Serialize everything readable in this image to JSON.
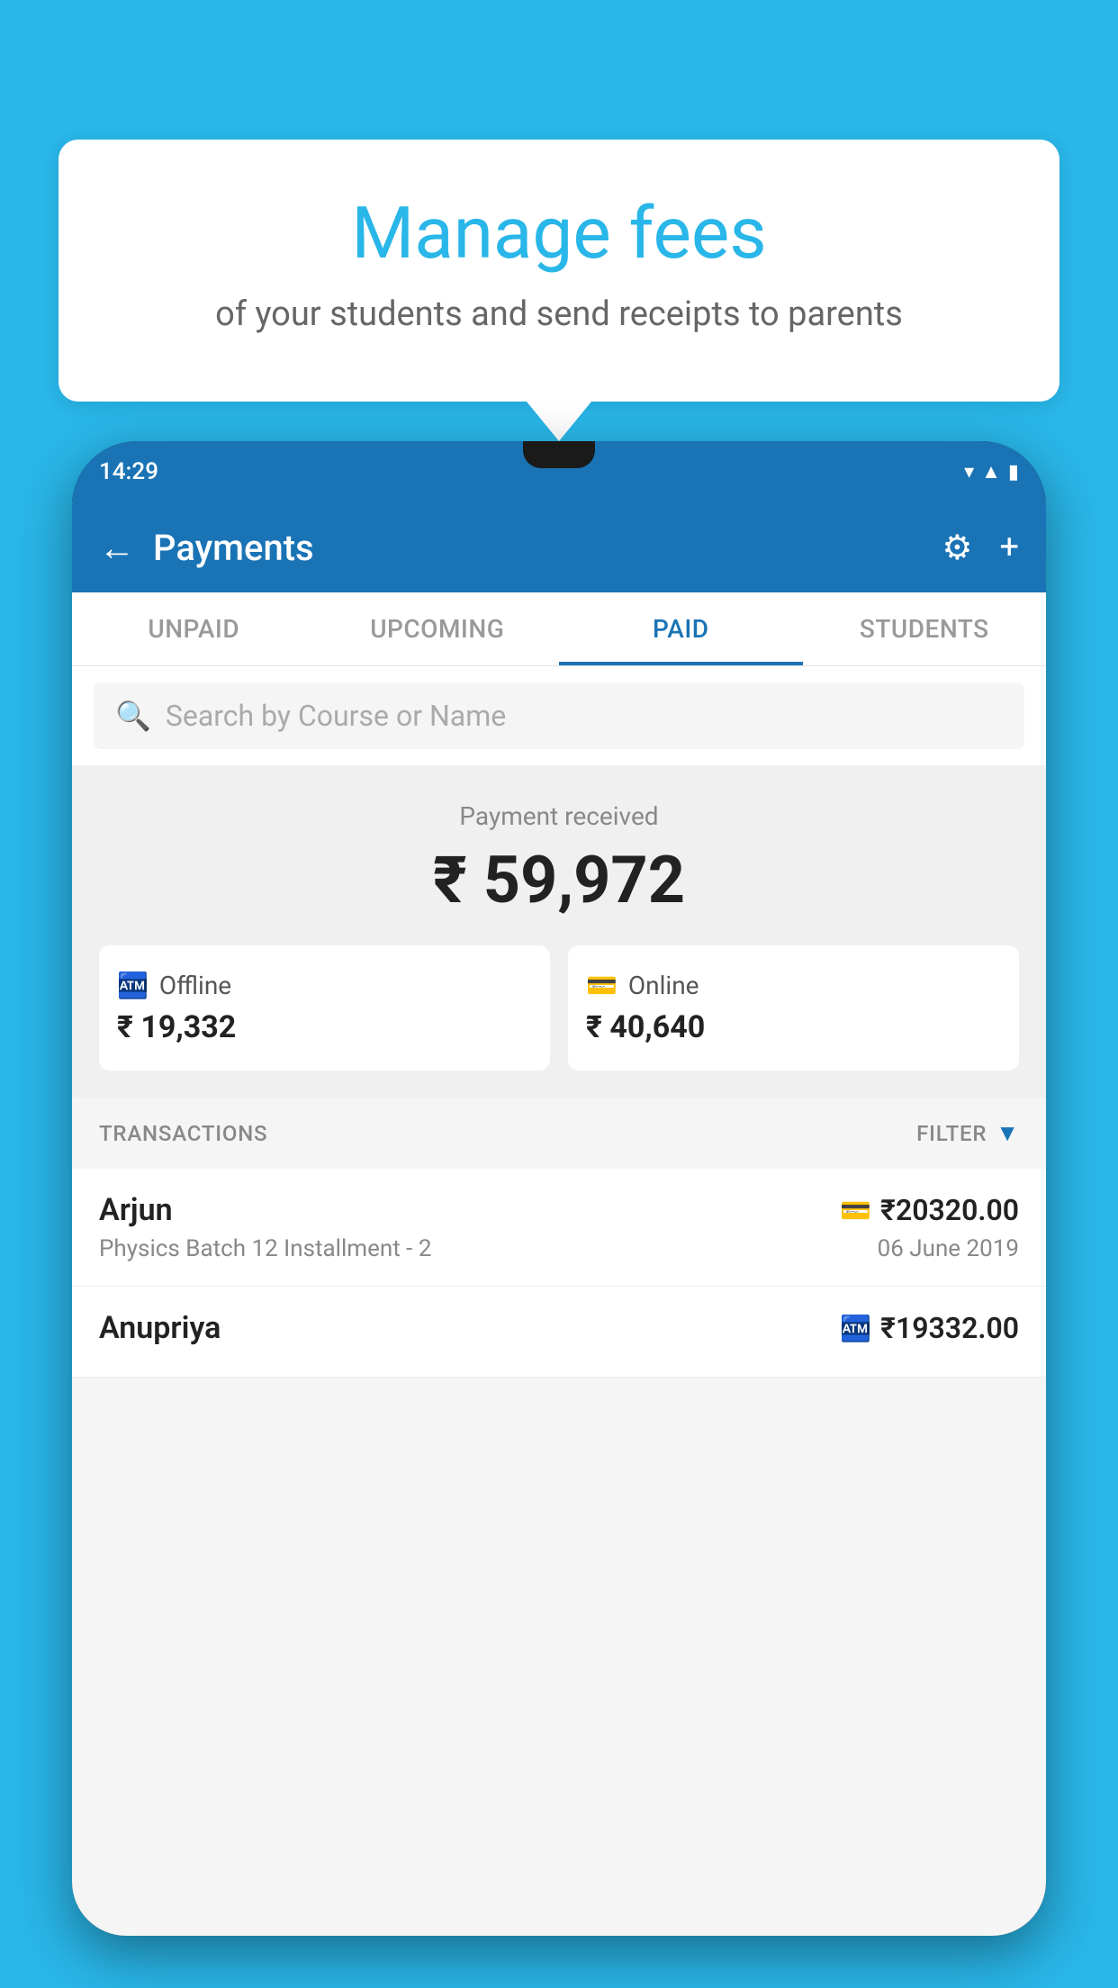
{
  "page": {
    "background_color": "#29B6E8"
  },
  "bubble": {
    "title": "Manage fees",
    "subtitle": "of your students and send receipts to parents"
  },
  "status_bar": {
    "time": "14:29",
    "wifi_icon": "wifi",
    "signal_icon": "signal",
    "battery_icon": "battery"
  },
  "header": {
    "title": "Payments",
    "back_label": "←",
    "settings_label": "⚙",
    "add_label": "+"
  },
  "tabs": [
    {
      "id": "unpaid",
      "label": "UNPAID",
      "active": false
    },
    {
      "id": "upcoming",
      "label": "UPCOMING",
      "active": false
    },
    {
      "id": "paid",
      "label": "PAID",
      "active": true
    },
    {
      "id": "students",
      "label": "STUDENTS",
      "active": false
    }
  ],
  "search": {
    "placeholder": "Search by Course or Name"
  },
  "payment_summary": {
    "label": "Payment received",
    "amount": "₹ 59,972",
    "offline": {
      "label": "Offline",
      "amount": "₹ 19,332"
    },
    "online": {
      "label": "Online",
      "amount": "₹ 40,640"
    }
  },
  "transactions": {
    "header_label": "TRANSACTIONS",
    "filter_label": "FILTER",
    "rows": [
      {
        "name": "Arjun",
        "type_icon": "card",
        "amount": "₹20320.00",
        "description": "Physics Batch 12 Installment - 2",
        "date": "06 June 2019"
      },
      {
        "name": "Anupriya",
        "type_icon": "cash",
        "amount": "₹19332.00",
        "description": "",
        "date": ""
      }
    ]
  }
}
